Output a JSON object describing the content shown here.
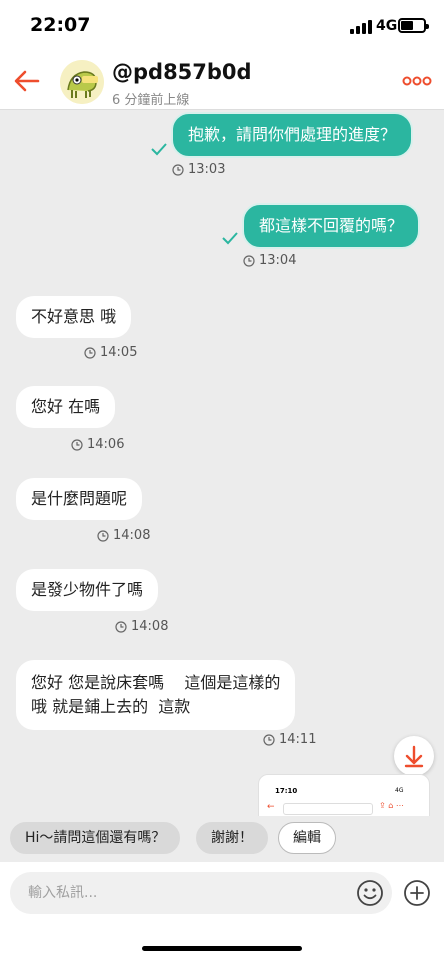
{
  "status_bar": {
    "time": "22:07",
    "network": "4G"
  },
  "header": {
    "username": "@pd857b0d",
    "last_seen": "6 分鐘前上線"
  },
  "messages": [
    {
      "side": "out",
      "text": "抱歉，請問你們處理的進度？",
      "time": "13:03"
    },
    {
      "side": "out",
      "text": "都這樣不回覆的嗎？",
      "time": "13:04"
    },
    {
      "side": "in",
      "text": "不好意思 哦",
      "time": "14:05"
    },
    {
      "side": "in",
      "text": "您好  在嗎",
      "time": "14:06"
    },
    {
      "side": "in",
      "text": "是什麼問題呢",
      "time": "14:08"
    },
    {
      "side": "in",
      "text": "是發少物件了嗎",
      "time": "14:08"
    },
    {
      "side": "in",
      "line1": "您好 您是說床套嗎    這個是這樣的",
      "line2": "哦 就是鋪上去的  這款",
      "time": "14:11"
    }
  ],
  "thumbnail": {
    "time": "17:10",
    "network": "4G"
  },
  "quick_replies": [
    "Hi～請問這個還有嗎？",
    "謝謝！",
    "編輯"
  ],
  "input": {
    "placeholder": "輸入私訊..."
  },
  "colors": {
    "accent": "#ee4d2d",
    "bubble_out": "#2bb6a0",
    "bubble_in": "#ffffff",
    "background": "#ececec"
  }
}
